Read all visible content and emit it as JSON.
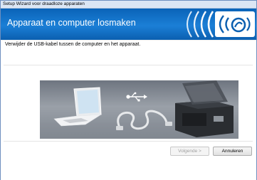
{
  "window": {
    "title": "Setup Wizard voor draadloze apparaten"
  },
  "header": {
    "title": "Apparaat en computer losmaken"
  },
  "main": {
    "instruction": "Verwijder de USB-kabel tussen de computer en het apparaat."
  },
  "footer": {
    "next_label": "Volgende >",
    "cancel_label": "Annuleren"
  },
  "colors": {
    "header_blue": "#1b7fd6",
    "logo_blue": "#0b5fb0"
  },
  "icons": [
    "wireless-logo-icon",
    "usb-icon",
    "laptop-icon",
    "usb-cable-icon",
    "printer-icon"
  ]
}
